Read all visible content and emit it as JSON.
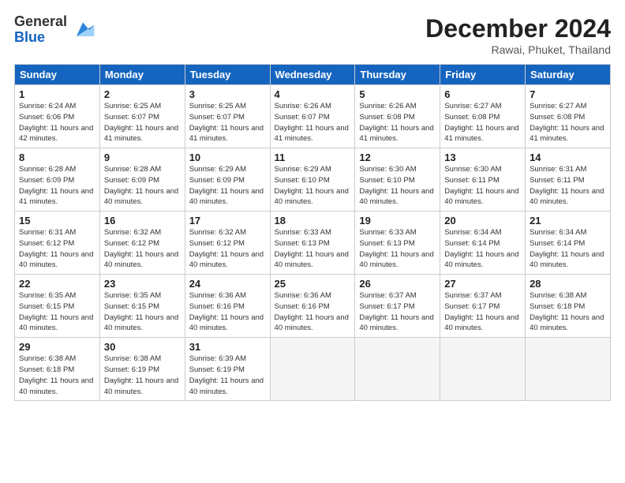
{
  "logo": {
    "general": "General",
    "blue": "Blue"
  },
  "header": {
    "month": "December 2024",
    "location": "Rawai, Phuket, Thailand"
  },
  "days": [
    "Sunday",
    "Monday",
    "Tuesday",
    "Wednesday",
    "Thursday",
    "Friday",
    "Saturday"
  ],
  "weeks": [
    [
      {
        "day": "1",
        "sunrise": "6:24 AM",
        "sunset": "6:06 PM",
        "daylight": "11 hours and 42 minutes."
      },
      {
        "day": "2",
        "sunrise": "6:25 AM",
        "sunset": "6:07 PM",
        "daylight": "11 hours and 41 minutes."
      },
      {
        "day": "3",
        "sunrise": "6:25 AM",
        "sunset": "6:07 PM",
        "daylight": "11 hours and 41 minutes."
      },
      {
        "day": "4",
        "sunrise": "6:26 AM",
        "sunset": "6:07 PM",
        "daylight": "11 hours and 41 minutes."
      },
      {
        "day": "5",
        "sunrise": "6:26 AM",
        "sunset": "6:08 PM",
        "daylight": "11 hours and 41 minutes."
      },
      {
        "day": "6",
        "sunrise": "6:27 AM",
        "sunset": "6:08 PM",
        "daylight": "11 hours and 41 minutes."
      },
      {
        "day": "7",
        "sunrise": "6:27 AM",
        "sunset": "6:08 PM",
        "daylight": "11 hours and 41 minutes."
      }
    ],
    [
      {
        "day": "8",
        "sunrise": "6:28 AM",
        "sunset": "6:09 PM",
        "daylight": "11 hours and 41 minutes."
      },
      {
        "day": "9",
        "sunrise": "6:28 AM",
        "sunset": "6:09 PM",
        "daylight": "11 hours and 40 minutes."
      },
      {
        "day": "10",
        "sunrise": "6:29 AM",
        "sunset": "6:09 PM",
        "daylight": "11 hours and 40 minutes."
      },
      {
        "day": "11",
        "sunrise": "6:29 AM",
        "sunset": "6:10 PM",
        "daylight": "11 hours and 40 minutes."
      },
      {
        "day": "12",
        "sunrise": "6:30 AM",
        "sunset": "6:10 PM",
        "daylight": "11 hours and 40 minutes."
      },
      {
        "day": "13",
        "sunrise": "6:30 AM",
        "sunset": "6:11 PM",
        "daylight": "11 hours and 40 minutes."
      },
      {
        "day": "14",
        "sunrise": "6:31 AM",
        "sunset": "6:11 PM",
        "daylight": "11 hours and 40 minutes."
      }
    ],
    [
      {
        "day": "15",
        "sunrise": "6:31 AM",
        "sunset": "6:12 PM",
        "daylight": "11 hours and 40 minutes."
      },
      {
        "day": "16",
        "sunrise": "6:32 AM",
        "sunset": "6:12 PM",
        "daylight": "11 hours and 40 minutes."
      },
      {
        "day": "17",
        "sunrise": "6:32 AM",
        "sunset": "6:12 PM",
        "daylight": "11 hours and 40 minutes."
      },
      {
        "day": "18",
        "sunrise": "6:33 AM",
        "sunset": "6:13 PM",
        "daylight": "11 hours and 40 minutes."
      },
      {
        "day": "19",
        "sunrise": "6:33 AM",
        "sunset": "6:13 PM",
        "daylight": "11 hours and 40 minutes."
      },
      {
        "day": "20",
        "sunrise": "6:34 AM",
        "sunset": "6:14 PM",
        "daylight": "11 hours and 40 minutes."
      },
      {
        "day": "21",
        "sunrise": "6:34 AM",
        "sunset": "6:14 PM",
        "daylight": "11 hours and 40 minutes."
      }
    ],
    [
      {
        "day": "22",
        "sunrise": "6:35 AM",
        "sunset": "6:15 PM",
        "daylight": "11 hours and 40 minutes."
      },
      {
        "day": "23",
        "sunrise": "6:35 AM",
        "sunset": "6:15 PM",
        "daylight": "11 hours and 40 minutes."
      },
      {
        "day": "24",
        "sunrise": "6:36 AM",
        "sunset": "6:16 PM",
        "daylight": "11 hours and 40 minutes."
      },
      {
        "day": "25",
        "sunrise": "6:36 AM",
        "sunset": "6:16 PM",
        "daylight": "11 hours and 40 minutes."
      },
      {
        "day": "26",
        "sunrise": "6:37 AM",
        "sunset": "6:17 PM",
        "daylight": "11 hours and 40 minutes."
      },
      {
        "day": "27",
        "sunrise": "6:37 AM",
        "sunset": "6:17 PM",
        "daylight": "11 hours and 40 minutes."
      },
      {
        "day": "28",
        "sunrise": "6:38 AM",
        "sunset": "6:18 PM",
        "daylight": "11 hours and 40 minutes."
      }
    ],
    [
      {
        "day": "29",
        "sunrise": "6:38 AM",
        "sunset": "6:18 PM",
        "daylight": "11 hours and 40 minutes."
      },
      {
        "day": "30",
        "sunrise": "6:38 AM",
        "sunset": "6:19 PM",
        "daylight": "11 hours and 40 minutes."
      },
      {
        "day": "31",
        "sunrise": "6:39 AM",
        "sunset": "6:19 PM",
        "daylight": "11 hours and 40 minutes."
      },
      null,
      null,
      null,
      null
    ]
  ]
}
